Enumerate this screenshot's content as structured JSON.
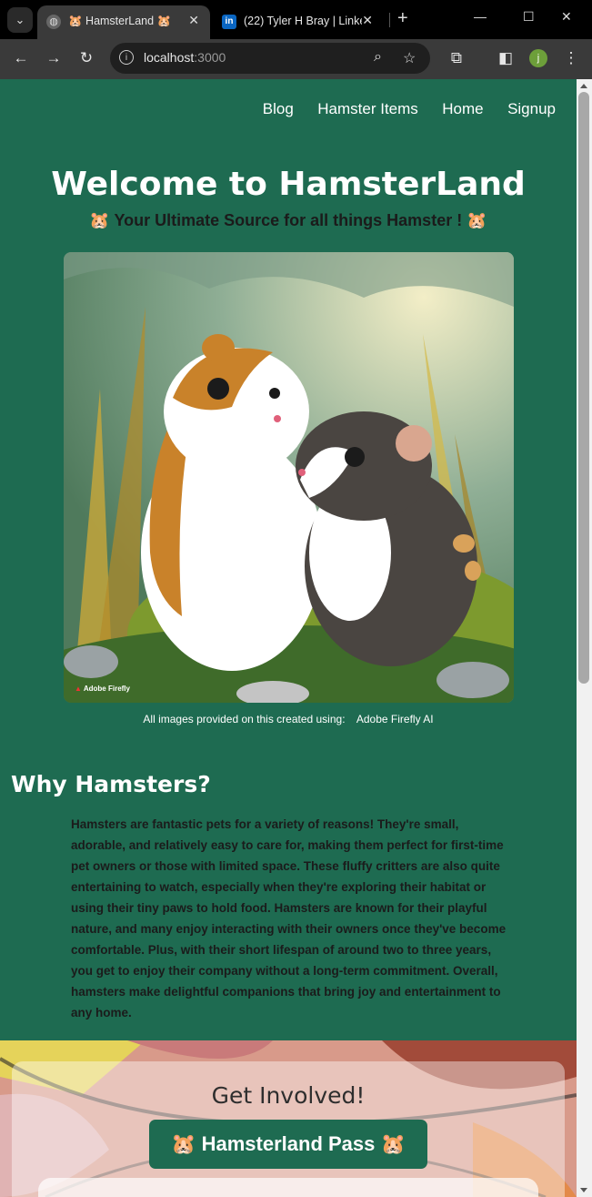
{
  "browser": {
    "tabs": [
      {
        "title": "🐹 HamsterLand 🐹",
        "favicon": "globe-icon",
        "active": true
      },
      {
        "title": "(22) Tyler H Bray | Linke",
        "favicon": "in",
        "active": false
      }
    ],
    "url_host": "localhost",
    "url_port": ":3000",
    "profile_initial": "j"
  },
  "nav": {
    "items": [
      "Blog",
      "Hamster Items",
      "Home",
      "Signup"
    ]
  },
  "hero": {
    "title": "Welcome to HamsterLand",
    "subtitle": "🐹 Your Ultimate Source for all things Hamster ! 🐹",
    "image_badge": "Adobe Firefly",
    "credit_text": "All images provided on this created using:",
    "credit_link": "Adobe Firefly AI"
  },
  "why": {
    "heading": "Why Hamsters?",
    "paragraph": "Hamsters are fantastic pets for a variety of reasons! They're small, adorable, and relatively easy to care for, making them perfect for first-time pet owners or those with limited space. These fluffy critters are also quite entertaining to watch, especially when they're exploring their habitat or using their tiny paws to hold food. Hamsters are known for their playful nature, and many enjoy interacting with their owners once they've become comfortable. Plus, with their short lifespan of around two to three years, you get to enjoy their company without a long-term commitment. Overall, hamsters make delightful companions that bring joy and entertainment to any home."
  },
  "involved": {
    "heading": "Get Involved!",
    "button": "🐹 Hamsterland Pass 🐹"
  },
  "colors": {
    "page_bg": "#1e6b51",
    "browser_bg": "#3a3a3a"
  }
}
